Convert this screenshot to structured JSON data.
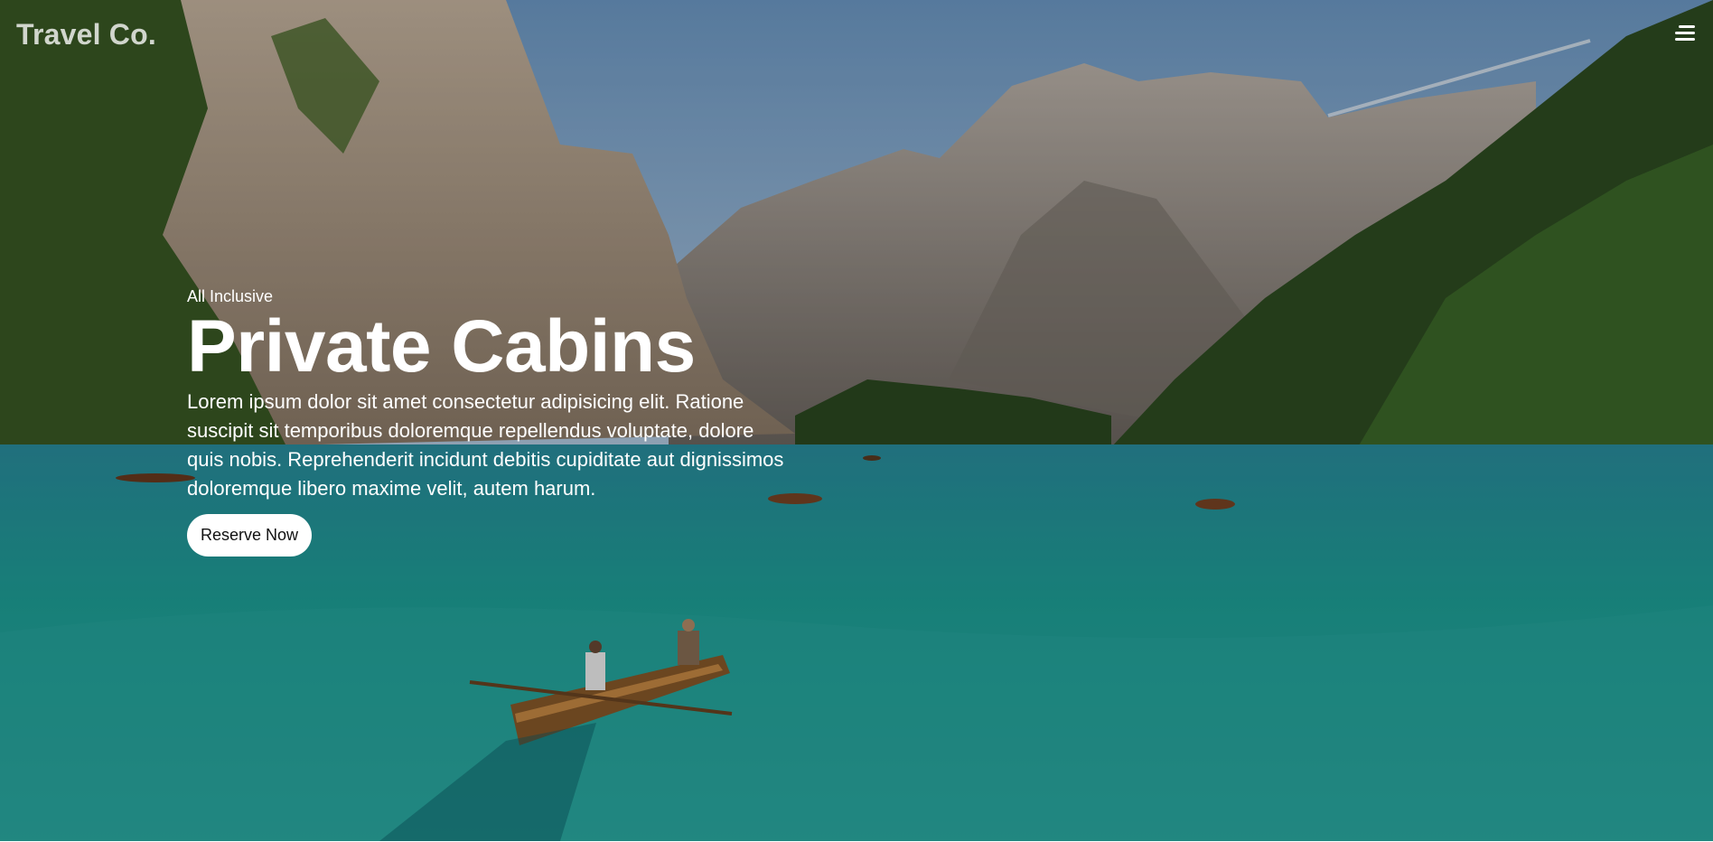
{
  "header": {
    "logo_text": "Travel Co.",
    "menu_icon": "hamburger-menu-icon"
  },
  "hero": {
    "eyebrow": "All Inclusive",
    "title": "Private Cabins",
    "description": "Lorem ipsum dolor sit amet consectetur adipisicing elit. Ratione suscipit sit temporibus doloremque repellendus voluptate, dolore quis nobis. Reprehenderit incidunt debitis cupiditate aut dignissimos doloremque libero maxime velit, autem harum.",
    "cta_label": "Reserve Now",
    "background_image": "mountain lake with rowboats"
  },
  "colors": {
    "sky": "#8fb2d4",
    "water": "#1f9a92",
    "forest": "#2f4d22",
    "cta_bg": "#ffffff",
    "text": "#ffffff"
  }
}
